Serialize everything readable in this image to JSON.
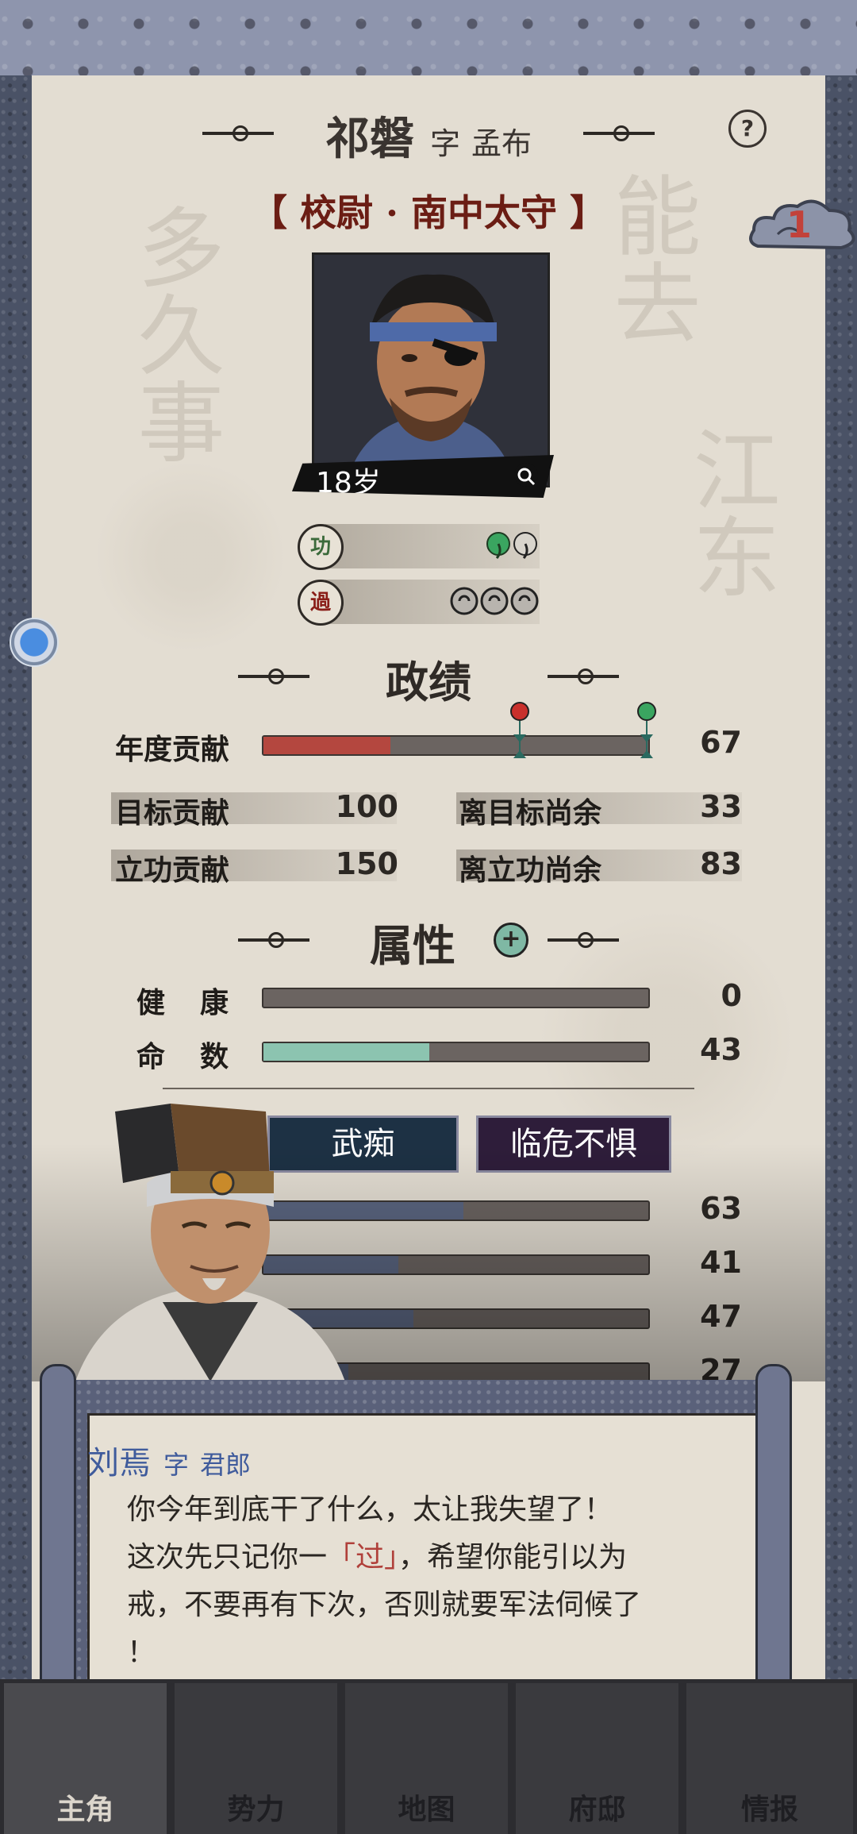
{
  "header": {
    "name": "祁磐",
    "zi_label": "字",
    "courtesy_name": "孟布",
    "help_glyph": "?",
    "title": "【 校尉 · 南中太守 】",
    "notification_count": "1"
  },
  "portrait": {
    "age": "18岁"
  },
  "merits": {
    "gong_label": "功",
    "guo_label": "過"
  },
  "performance": {
    "title": "政绩",
    "annual_label": "年度贡献",
    "annual_value": "67",
    "annual_progress": 0.44,
    "target_label": "目标贡献",
    "target_value": "100",
    "remaining_target_label": "离目标尚余",
    "remaining_target_value": "33",
    "merit_label": "立功贡献",
    "merit_value": "150",
    "remaining_merit_label": "离立功尚余",
    "remaining_merit_value": "83"
  },
  "attributes": {
    "title": "属性",
    "health_label": "健　康",
    "health_value": "0",
    "health_progress": 0.0,
    "fate_label": "命　数",
    "fate_value": "43",
    "fate_progress": 0.43,
    "fate_color": "#8cc4b0",
    "traits": [
      "武痴",
      "临危不惧"
    ],
    "other_values": [
      "63",
      "41",
      "47",
      "27"
    ],
    "other_progress": [
      0.52,
      0.35,
      0.39,
      0.22
    ]
  },
  "dialog": {
    "speaker": "刘焉",
    "zi_label": "字",
    "speaker_courtesy": "君郎",
    "line1": "你今年到底干了什么，太让我失望了！",
    "line2_a": "这次先只记你一",
    "line2_highlight": "「过」",
    "line2_b": "，希望你能引以为",
    "line3": "戒，不要再有下次，否则就要军法伺候了",
    "line4": "！"
  },
  "nav": {
    "items": [
      "主角",
      "势力",
      "地图",
      "府邸",
      "情报"
    ]
  },
  "colors": {
    "accent_red": "#6b1d14",
    "dialog_name_blue": "#3f5b9c",
    "bar_red": "#b4473f"
  }
}
